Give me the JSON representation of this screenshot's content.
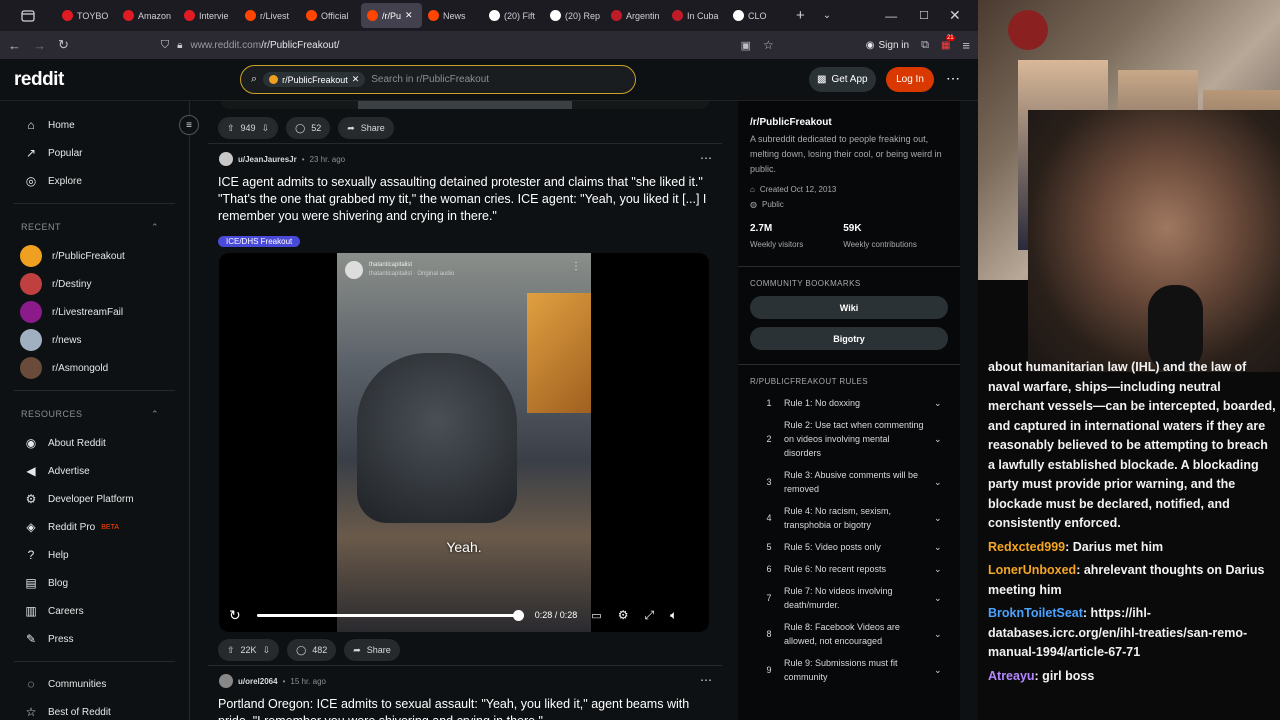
{
  "browser": {
    "tabs": [
      {
        "label": "TOYBO",
        "color": "#e01b24"
      },
      {
        "label": "Amazon",
        "color": "#e01b24"
      },
      {
        "label": "Intervie",
        "color": "#e01b24"
      },
      {
        "label": "r/Livest",
        "color": "#ff4500"
      },
      {
        "label": "Official",
        "color": "#ff4500"
      },
      {
        "label": "/r/Pu",
        "color": "#ff4500"
      },
      {
        "label": "News",
        "color": "#ff4500"
      },
      {
        "label": "(20) Fift",
        "color": "#ffffff"
      },
      {
        "label": "(20) Rep",
        "color": "#ffffff"
      },
      {
        "label": "Argentin",
        "color": "#c01c28"
      },
      {
        "label": "In Cuba",
        "color": "#c01c28"
      },
      {
        "label": "CLO",
        "color": "#ffffff"
      }
    ],
    "url": "www.reddit.com/r/PublicFreakout/",
    "url_host": "www.reddit.com",
    "url_path": "/r/PublicFreakout/",
    "sign_in": "Sign in",
    "badge": "21"
  },
  "header": {
    "logo": "reddit",
    "search_chip": "r/PublicFreakout",
    "search_placeholder": "Search in r/PublicFreakout",
    "get_app": "Get App",
    "log_in": "Log In"
  },
  "sidebar": {
    "main": [
      {
        "label": "Home",
        "icon": "home-icon"
      },
      {
        "label": "Popular",
        "icon": "popular-icon"
      },
      {
        "label": "Explore",
        "icon": "explore-icon"
      }
    ],
    "recent_title": "RECENT",
    "recent": [
      {
        "label": "r/PublicFreakout",
        "color": "#f0a020"
      },
      {
        "label": "r/Destiny",
        "color": "#c04040"
      },
      {
        "label": "r/LivestreamFail",
        "color": "#8b1a8b"
      },
      {
        "label": "r/news",
        "color": "#a0b0c0"
      },
      {
        "label": "r/Asmongold",
        "color": "#6a4a3a"
      }
    ],
    "resources_title": "RESOURCES",
    "resources": [
      {
        "label": "About Reddit",
        "icon": "about-icon"
      },
      {
        "label": "Advertise",
        "icon": "advertise-icon"
      },
      {
        "label": "Developer Platform",
        "icon": "developer-icon"
      },
      {
        "label": "Reddit Pro",
        "icon": "pro-icon",
        "badge": "BETA"
      },
      {
        "label": "Help",
        "icon": "help-icon"
      },
      {
        "label": "Blog",
        "icon": "blog-icon"
      },
      {
        "label": "Careers",
        "icon": "careers-icon"
      },
      {
        "label": "Press",
        "icon": "press-icon"
      }
    ],
    "bottom": [
      {
        "label": "Communities",
        "icon": "communities-icon"
      },
      {
        "label": "Best of Reddit",
        "icon": "best-icon"
      }
    ]
  },
  "feed": {
    "prev_actions": {
      "votes": "949",
      "comments": "52",
      "share": "Share"
    },
    "post1": {
      "author": "u/JeanJauresJr",
      "age": "23 hr. ago",
      "title": "ICE agent admits to sexually assaulting detained protester and claims that \"she liked it.\" \"That's the one that grabbed my tit,\" the woman cries. ICE agent: \"Yeah, you liked it [...] I remember you were shivering and crying in there.\"",
      "flair": "ICE/DHS Freakout",
      "video": {
        "channel": "thatanticapitalist",
        "audio": "thatanticapitalist · Original audio",
        "caption": "Yeah.",
        "time": "0:28 / 0:28",
        "progress": 1.0
      },
      "votes": "22K",
      "comments": "482",
      "share": "Share"
    },
    "post2": {
      "author": "u/orel2064",
      "age": "15 hr. ago",
      "title": "Portland Oregon: ICE admits to sexual assault: \"Yeah, you liked it,\" agent beams with pride. \"I remember you were shivering and crying in there.\""
    }
  },
  "community": {
    "name": "/r/PublicFreakout",
    "description": "A subreddit dedicated to people freaking out, melting down, losing their cool, or being weird in public.",
    "created": "Created Oct 12, 2013",
    "visibility": "Public",
    "visitors_value": "2.7M",
    "visitors_label": "Weekly visitors",
    "contrib_value": "59K",
    "contrib_label": "Weekly contributions",
    "bookmarks_title": "COMMUNITY BOOKMARKS",
    "bookmarks": [
      "Wiki",
      "Bigotry"
    ],
    "rules_title": "R/PUBLICFREAKOUT RULES",
    "rules": [
      {
        "n": "1",
        "text": "Rule 1: No doxxing"
      },
      {
        "n": "2",
        "text": "Rule 2: Use tact when commenting on videos involving mental disorders"
      },
      {
        "n": "3",
        "text": "Rule 3: Abusive comments will be removed"
      },
      {
        "n": "4",
        "text": "Rule 4: No racism, sexism, transphobia or bigotry"
      },
      {
        "n": "5",
        "text": "Rule 5: Video posts only"
      },
      {
        "n": "6",
        "text": "Rule 6: No recent reposts"
      },
      {
        "n": "7",
        "text": "Rule 7: No videos involving death/murder."
      },
      {
        "n": "8",
        "text": "Rule 8: Facebook Videos are allowed, not encouraged"
      },
      {
        "n": "9",
        "text": "Rule 9: Submissions must fit community"
      }
    ]
  },
  "stream_chat": {
    "overlay_text": "about humanitarian law (IHL) and the law of naval warfare, ships—including neutral merchant vessels—can be intercepted, boarded, and captured in international waters if they are reasonably believed to be attempting to breach a lawfully established blockade. A blockading party must provide prior warning, and the blockade must be declared, notified, and consistently enforced.",
    "messages": [
      {
        "user": "Redxcted999",
        "color": "#f5a623",
        "text": ": Darius met him"
      },
      {
        "user": "LonerUnboxed",
        "color": "#f5a623",
        "text": ": ahrelevant thoughts on Darius meeting him"
      },
      {
        "user": "BroknToiletSeat",
        "color": "#4aa3ff",
        "text": ": https://ihl-databases.icrc.org/en/ihl-treaties/san-remo-manual-1994/article-67-71"
      },
      {
        "user": "Atreayu",
        "color": "#b388ff",
        "text": ": girl boss"
      }
    ]
  }
}
